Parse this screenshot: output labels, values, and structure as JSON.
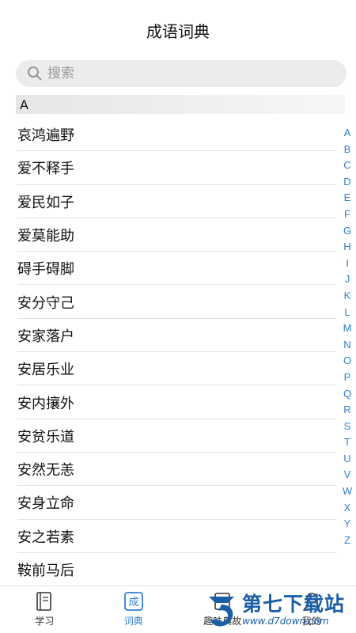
{
  "header": {
    "title": "成语词典"
  },
  "search": {
    "placeholder": "搜索"
  },
  "section": {
    "letter": "A"
  },
  "list": {
    "items": [
      "哀鸿遍野",
      "爱不释手",
      "爱民如子",
      "爱莫能助",
      "碍手碍脚",
      "安分守己",
      "安家落户",
      "安居乐业",
      "安内攘外",
      "安贫乐道",
      "安然无恙",
      "安身立命",
      "安之若素",
      "鞍前马后"
    ]
  },
  "index": {
    "letters": [
      "A",
      "B",
      "C",
      "D",
      "E",
      "F",
      "G",
      "H",
      "I",
      "J",
      "K",
      "L",
      "M",
      "N",
      "O",
      "P",
      "Q",
      "R",
      "S",
      "T",
      "U",
      "V",
      "W",
      "X",
      "Y",
      "Z"
    ]
  },
  "tabbar": {
    "tabs": [
      {
        "label": "学习",
        "icon": "book-icon"
      },
      {
        "label": "词典",
        "icon": "dictionary-icon"
      },
      {
        "label": "趣味典故",
        "icon": "story-icon"
      },
      {
        "label": "我的",
        "icon": "profile-icon"
      }
    ],
    "active_index": 1
  },
  "watermark": {
    "text": "第七下载站",
    "url": "www.d7down.com"
  },
  "colors": {
    "accent": "#2f7fd6",
    "watermark": "#1a5ea8"
  }
}
